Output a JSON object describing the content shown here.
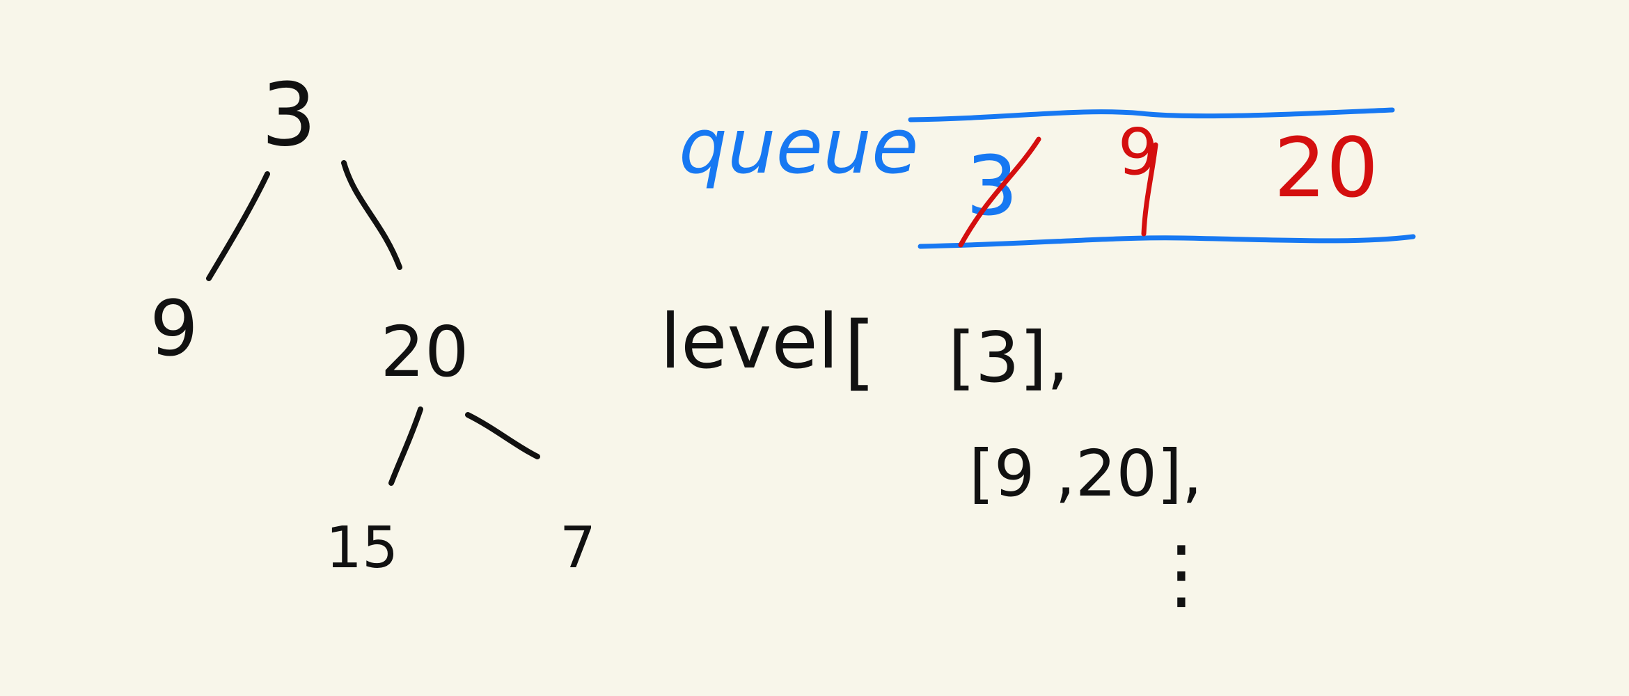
{
  "colors": {
    "background": "#f8f6ea",
    "ink_black": "#111111",
    "ink_blue": "#1778f2",
    "ink_red": "#d40f0f"
  },
  "tree": {
    "nodes": [
      {
        "id": "root",
        "label": "3"
      },
      {
        "id": "left",
        "label": "9"
      },
      {
        "id": "right",
        "label": "20"
      },
      {
        "id": "right-left",
        "label": "15"
      },
      {
        "id": "right-right",
        "label": "7"
      }
    ]
  },
  "queue": {
    "label": "queue",
    "items": [
      {
        "label": "3",
        "crossed_out": true
      },
      {
        "label": "9",
        "crossed_out": true
      },
      {
        "label": "20",
        "crossed_out": false
      }
    ]
  },
  "level": {
    "label": "level",
    "open_bracket": "[",
    "row1": "[3],",
    "row2": "[9 ,20],",
    "continuation": "⋮"
  }
}
